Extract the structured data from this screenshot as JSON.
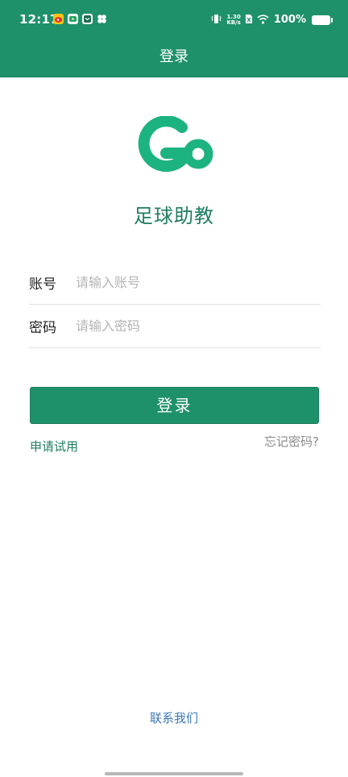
{
  "status_bar": {
    "time": "12:17",
    "notification_icons": [
      "weibo-icon",
      "video-app-icon",
      "messenger-icon",
      "clover-app-icon"
    ],
    "net_speed_value": "1.30",
    "net_speed_unit": "KB/s",
    "battery_percent": "100%"
  },
  "header": {
    "title": "登录"
  },
  "brand": {
    "logo_icon": "go-logo-icon",
    "app_name": "足球助教"
  },
  "form": {
    "account_label": "账号",
    "account_placeholder": "请输入账号",
    "password_label": "密码",
    "password_placeholder": "请输入密码",
    "login_button": "登录"
  },
  "links": {
    "apply_trial": "申请试用",
    "forgot_password": "忘记密码?",
    "contact_us": "联系我们"
  },
  "colors": {
    "primary": "#1f916a",
    "brand_text": "#1f7d62",
    "contact_link": "#3a78b8"
  }
}
